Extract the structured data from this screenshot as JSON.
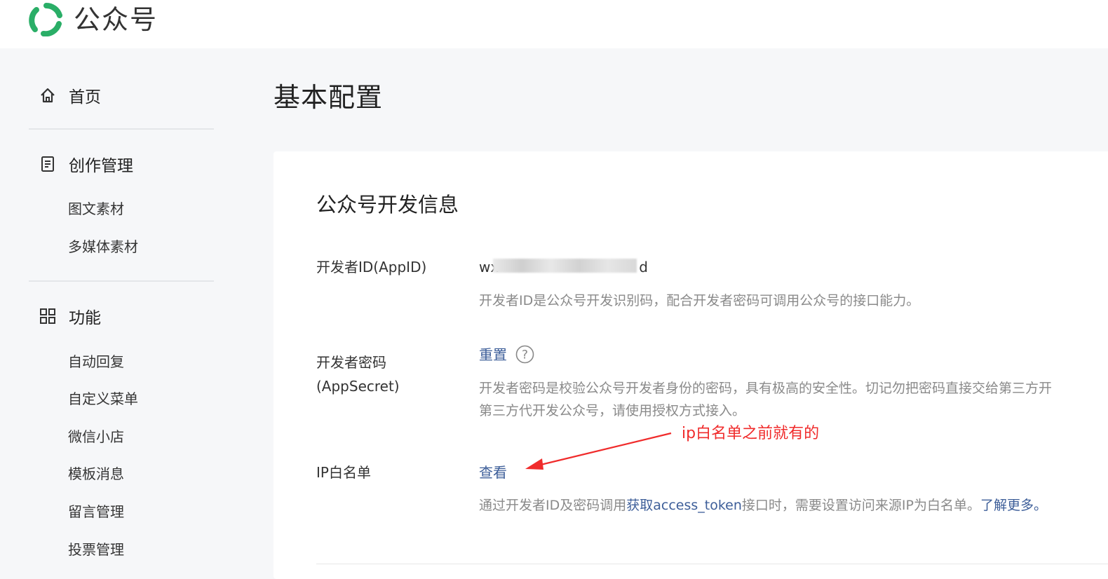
{
  "header": {
    "app_name": "公众号",
    "logo_icon": "wechat-official-account-logo-icon",
    "brand_color": "#2aae67"
  },
  "sidebar": {
    "groups": [
      {
        "label": "首页",
        "icon": "home-icon",
        "items": []
      },
      {
        "label": "创作管理",
        "icon": "document-icon",
        "items": [
          "图文素材",
          "多媒体素材"
        ]
      },
      {
        "label": "功能",
        "icon": "grid-icon",
        "items": [
          "自动回复",
          "自定义菜单",
          "微信小店",
          "模板消息",
          "留言管理",
          "投票管理"
        ]
      }
    ]
  },
  "main": {
    "title": "基本配置",
    "section_title": "公众号开发信息",
    "rows": {
      "appid": {
        "label": "开发者ID(AppID)",
        "value_prefix": "wx",
        "value_suffix": "d",
        "desc": "开发者ID是公众号开发识别码，配合开发者密码可调用公众号的接口能力。"
      },
      "appsecret": {
        "label": "开发者密码(AppSecret)",
        "action": "重置",
        "help_icon": "question-circle-icon",
        "desc_line1": "开发者密码是校验公众号开发者身份的密码，具有极高的安全性。切记勿把密码直接交给第三方开",
        "desc_line2": "第三方代开发公众号，请使用授权方式接入。"
      },
      "ip_whitelist": {
        "label": "IP白名单",
        "action": "查看",
        "desc_before": "通过开发者ID及密码调用",
        "desc_link": "获取access_token",
        "desc_middle": "接口时，需要设置访问来源IP为白名单。",
        "desc_more": "了解更多。"
      }
    }
  },
  "annotation": {
    "text": "ip白名单之前就有的",
    "color": "#f02b2b"
  },
  "colors": {
    "link": "#3d5e99",
    "desc": "#8a8a8a",
    "background": "#f6f7f9"
  }
}
